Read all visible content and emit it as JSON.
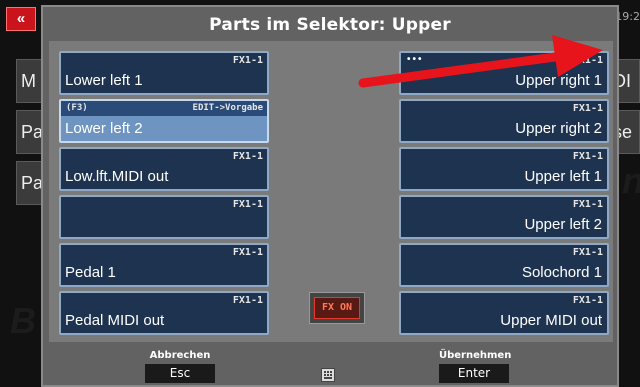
{
  "background": {
    "back_glyph": "«",
    "clock": "19:2",
    "left_tiles": [
      "M",
      "Pa",
      "Pa"
    ],
    "right_tiles": [
      "DI",
      "se"
    ],
    "watermarks": [
      "B",
      "n"
    ]
  },
  "dialog": {
    "title": "Parts im Selektor: Upper",
    "left_slots": [
      {
        "fx": "FX1-1",
        "name": "Lower left 1"
      },
      {
        "hint": "(F3)",
        "fx": "EDIT->Vorgabe",
        "name": "Lower left 2",
        "selected": true
      },
      {
        "fx": "FX1-1",
        "name": "Low.lft.MIDI out"
      },
      {
        "fx": "FX1-1",
        "name": ""
      },
      {
        "fx": "FX1-1",
        "name": "Pedal 1"
      },
      {
        "fx": "FX1-1",
        "name": "Pedal MIDI out"
      }
    ],
    "right_slots": [
      {
        "dots": "•••",
        "fx": "FX1-1",
        "name": "Upper right 1"
      },
      {
        "fx": "FX1-1",
        "name": "Upper right 2"
      },
      {
        "fx": "FX1-1",
        "name": "Upper left 1"
      },
      {
        "fx": "FX1-1",
        "name": "Upper left 2"
      },
      {
        "fx": "FX1-1",
        "name": "Solochord 1"
      },
      {
        "fx": "FX1-1",
        "name": "Upper MIDI out"
      }
    ],
    "fx_on_label": "FX ON",
    "footer": {
      "cancel_label": "Abbrechen",
      "cancel_key": "Esc",
      "keyboard_icon": "keyboard-icon",
      "confirm_label": "Übernehmen",
      "confirm_key": "Enter"
    }
  },
  "colors": {
    "slot_bg": "#1d3350",
    "slot_selected_bg": "#6e95c2",
    "arrow": "#e8141c",
    "fx_on": "#e33a2c"
  }
}
